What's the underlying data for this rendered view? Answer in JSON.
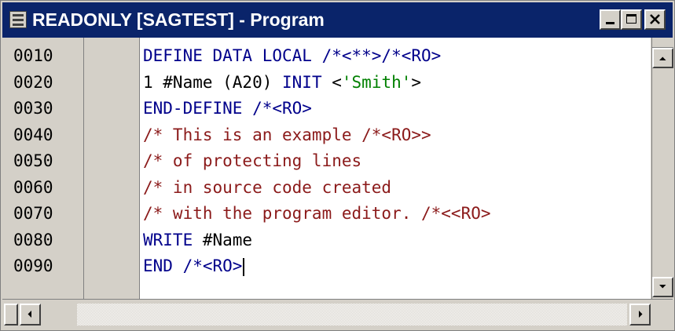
{
  "window": {
    "title": "READONLY [SAGTEST] - Program"
  },
  "icons": {
    "window": "program-window-icon",
    "minimize": "minimize-icon",
    "maximize": "maximize-icon",
    "close": "close-icon",
    "scroll_up": "arrow-up-icon",
    "scroll_down": "arrow-down-icon",
    "scroll_left": "arrow-left-icon",
    "scroll_right": "arrow-right-icon"
  },
  "colors": {
    "keyword": "#00008b",
    "comment": "#8b1a1a",
    "string": "#008000",
    "title_bar": "#0a246a"
  },
  "editor": {
    "lines": [
      {
        "number": "0010",
        "segments": [
          {
            "text": "DEFINE DATA LOCAL /*<**>/*<RO>",
            "type": "kw"
          }
        ]
      },
      {
        "number": "0020",
        "segments": [
          {
            "text": "1 #Name (A20) ",
            "type": "tx"
          },
          {
            "text": "INIT",
            "type": "kw"
          },
          {
            "text": " <",
            "type": "tx"
          },
          {
            "text": "'Smith'",
            "type": "str"
          },
          {
            "text": ">",
            "type": "tx"
          }
        ]
      },
      {
        "number": "0030",
        "segments": [
          {
            "text": "END-DEFINE /*<RO>",
            "type": "kw"
          }
        ]
      },
      {
        "number": "0040",
        "segments": [
          {
            "text": "/* This is an example /*<RO>>",
            "type": "cm"
          }
        ]
      },
      {
        "number": "0050",
        "segments": [
          {
            "text": "/* of protecting lines",
            "type": "cm"
          }
        ]
      },
      {
        "number": "0060",
        "segments": [
          {
            "text": "/* in source code created",
            "type": "cm"
          }
        ]
      },
      {
        "number": "0070",
        "segments": [
          {
            "text": "/* with the program editor. /*<<RO>",
            "type": "cm"
          }
        ]
      },
      {
        "number": "0080",
        "segments": [
          {
            "text": "WRITE",
            "type": "kw"
          },
          {
            "text": " #Name",
            "type": "tx"
          }
        ]
      },
      {
        "number": "0090",
        "segments": [
          {
            "text": "END /*<RO>",
            "type": "kw"
          }
        ]
      }
    ]
  }
}
